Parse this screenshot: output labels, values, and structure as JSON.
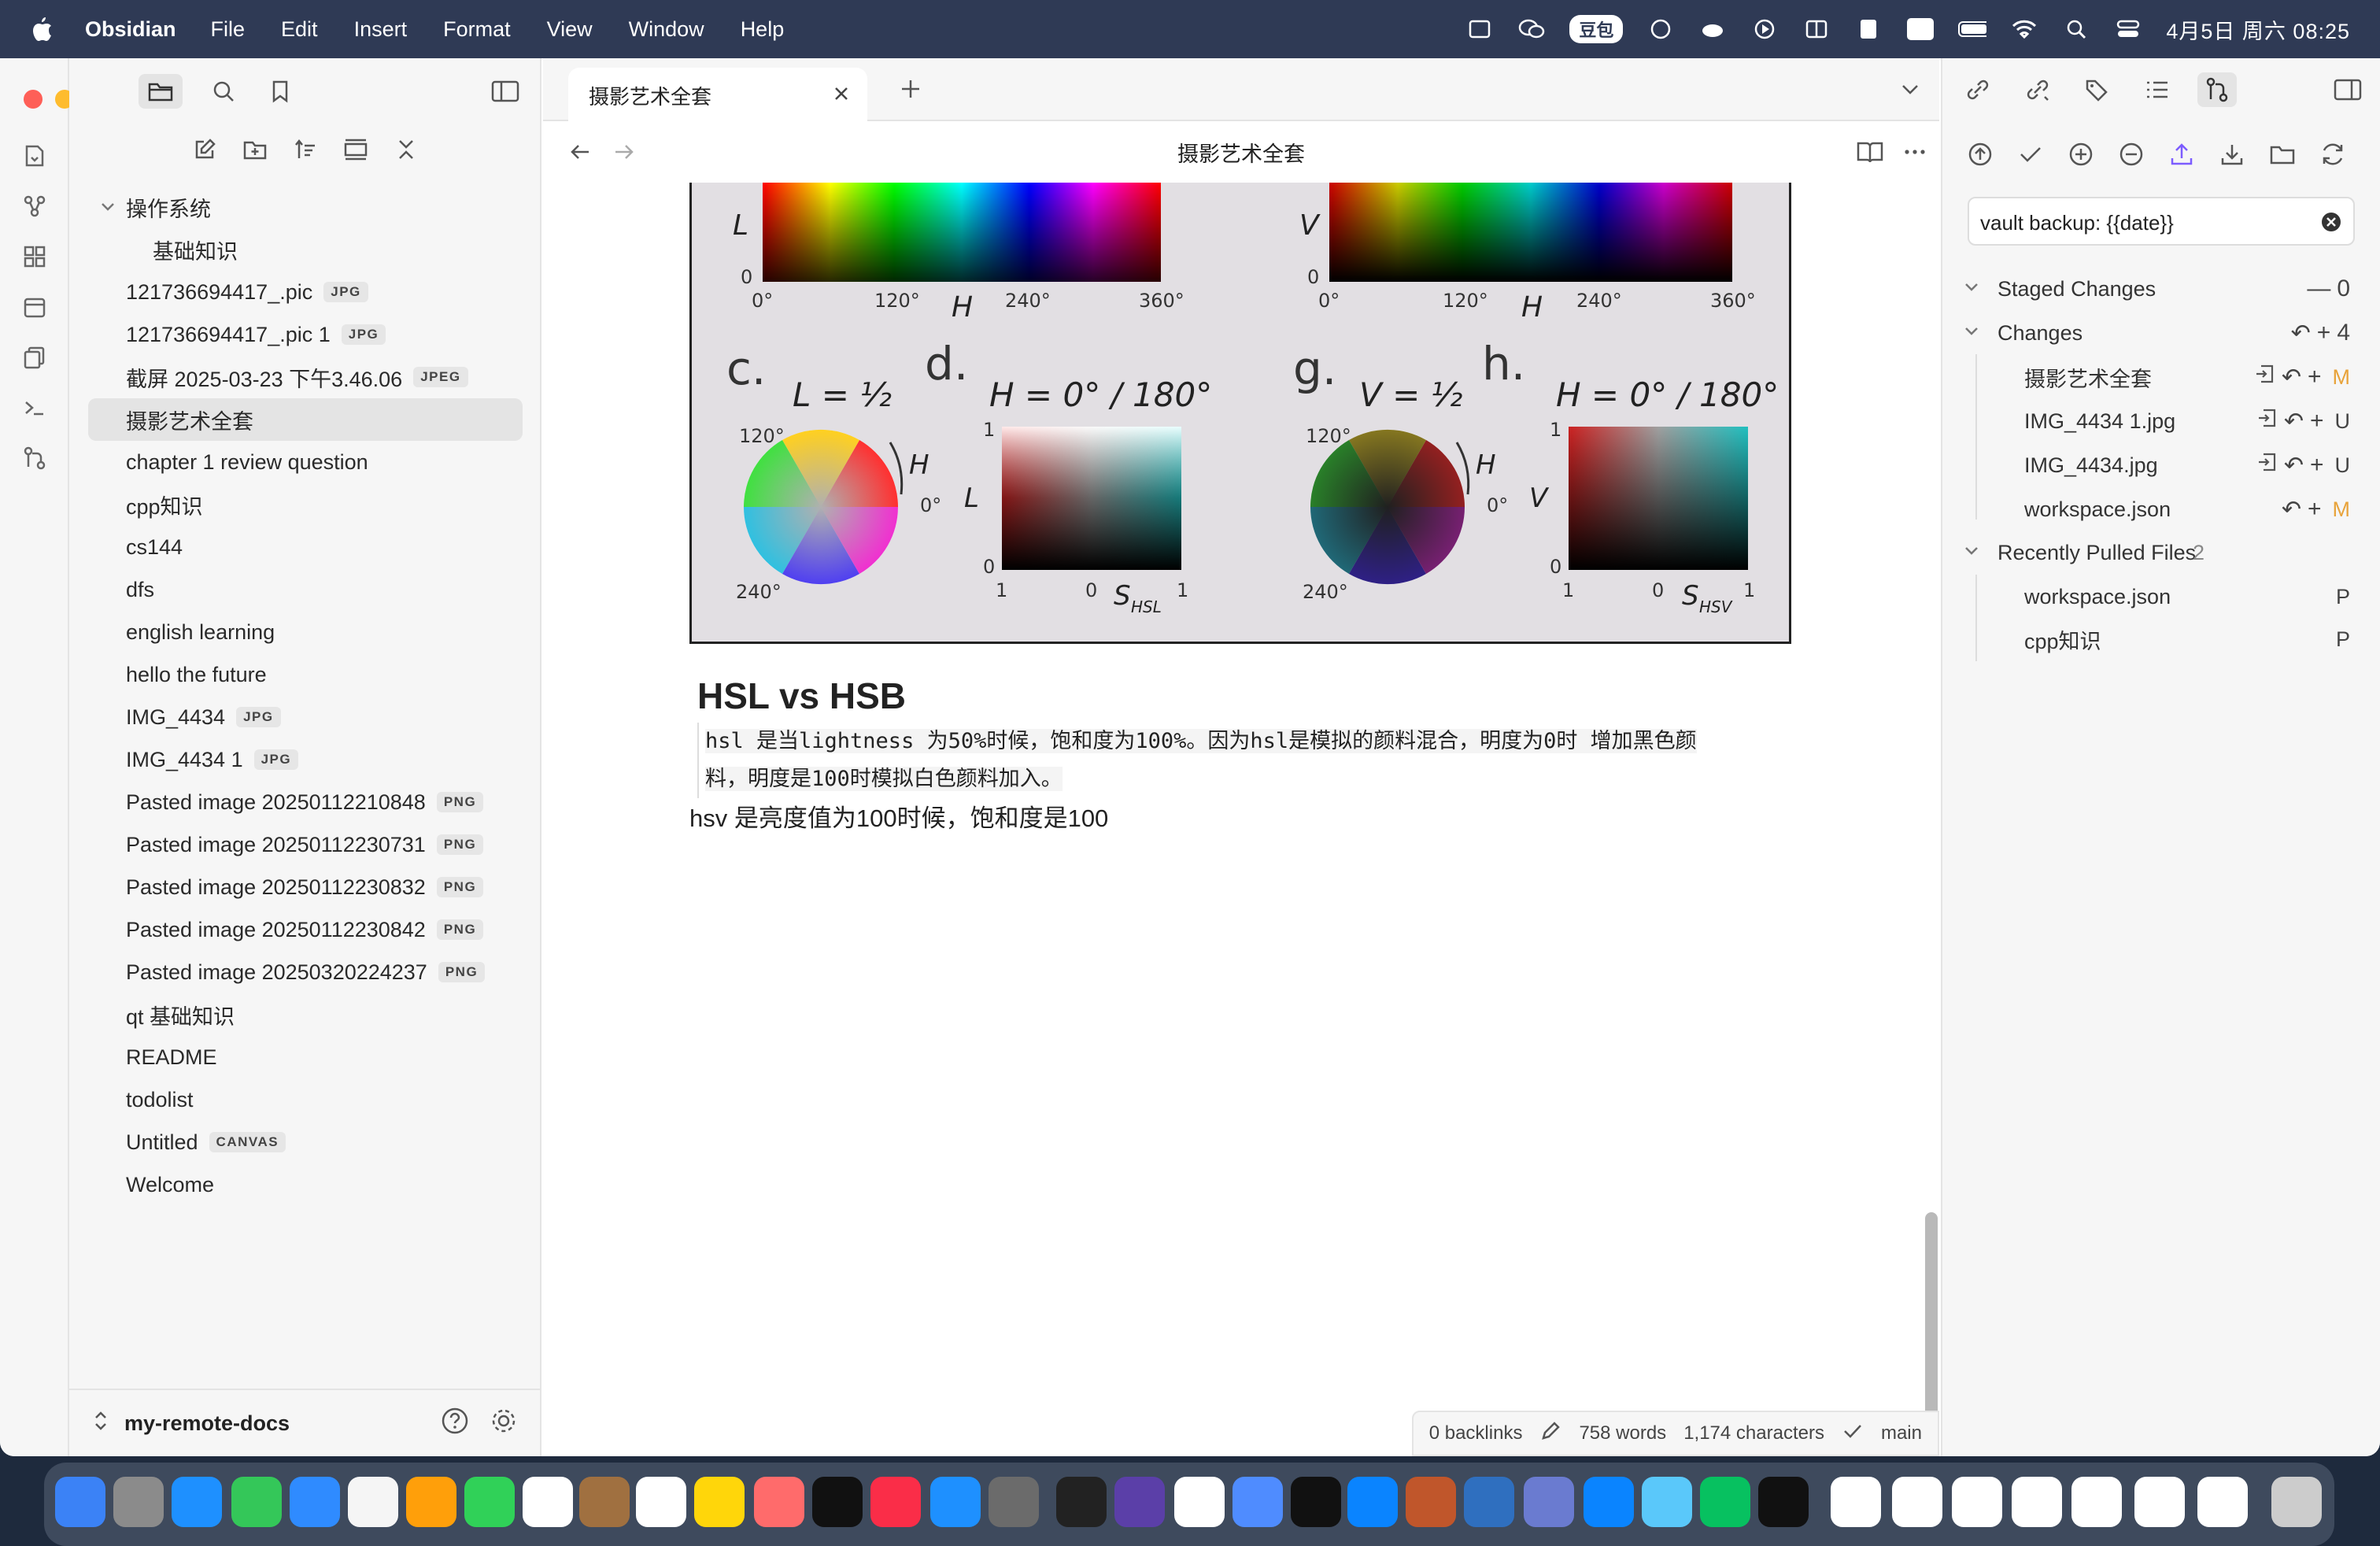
{
  "menubar": {
    "app": "Obsidian",
    "items": [
      "File",
      "Edit",
      "Insert",
      "Format",
      "View",
      "Window",
      "Help"
    ],
    "doubao": "豆包",
    "clock": "4月5日 周六  08:25"
  },
  "sidebar": {
    "tree": [
      {
        "label": "操作系统",
        "type": "folder"
      },
      {
        "label": "基础知识",
        "type": "child"
      },
      {
        "label": "121736694417_.pic",
        "badge": "JPG"
      },
      {
        "label": "121736694417_.pic 1",
        "badge": "JPG"
      },
      {
        "label": "截屏 2025-03-23 下午3.46.06",
        "badge": "JPEG"
      },
      {
        "label": "摄影艺术全套",
        "active": true
      },
      {
        "label": "chapter 1 review question"
      },
      {
        "label": "cpp知识"
      },
      {
        "label": "cs144"
      },
      {
        "label": "dfs"
      },
      {
        "label": "english learning"
      },
      {
        "label": "hello  the future"
      },
      {
        "label": "IMG_4434",
        "badge": "JPG"
      },
      {
        "label": "IMG_4434 1",
        "badge": "JPG"
      },
      {
        "label": "Pasted image 20250112210848",
        "badge": "PNG"
      },
      {
        "label": "Pasted image 20250112230731",
        "badge": "PNG"
      },
      {
        "label": "Pasted image 20250112230832",
        "badge": "PNG"
      },
      {
        "label": "Pasted image 20250112230842",
        "badge": "PNG"
      },
      {
        "label": "Pasted image 20250320224237",
        "badge": "PNG"
      },
      {
        "label": "qt 基础知识"
      },
      {
        "label": "README"
      },
      {
        "label": "todolist"
      },
      {
        "label": "Untitled",
        "badge": "CANVAS"
      },
      {
        "label": "Welcome"
      }
    ],
    "vault": "my-remote-docs"
  },
  "editor": {
    "tab_title": "摄影艺术全套",
    "view_title": "摄影艺术全套",
    "heading": "HSL vs HSB",
    "quote_line1": "  hsl 是当lightness 为50%时候，饱和度为100%。因为hsl是模拟的颜料混合，明度为0时 增加黑色颜",
    "quote_line2": "料，明度是100时模拟白色颜料加入。",
    "paragraph": "hsv 是亮度值为100时候，饱和度是100",
    "figure": {
      "ticks_h": [
        "0°",
        "120°",
        "240°",
        "360°"
      ],
      "axis_L": "L",
      "axis_V": "V",
      "axis_H": "H",
      "zero": "0",
      "panel_c": "c.",
      "panel_d": "d.",
      "panel_g": "g.",
      "panel_h": "h.",
      "title_c": "L = ½",
      "title_d": "H = 0° / 180°",
      "title_g": "V = ½",
      "title_h": "H = 0° / 180°",
      "wheel_120": "120°",
      "wheel_240": "240°",
      "wheel_0": "0°",
      "one": "1",
      "s_hsl": "S",
      "s_hsl_sub": "HSL",
      "s_hsv": "S",
      "s_hsv_sub": "HSV"
    }
  },
  "status": {
    "backlinks": "0 backlinks",
    "words": "758 words",
    "characters": "1,174 characters",
    "branch": "main"
  },
  "git": {
    "commit_message": "vault backup: {{date}}",
    "staged_label": "Staged Changes",
    "staged_count": "0",
    "changes_label": "Changes",
    "changes_count": "4",
    "changes": [
      {
        "name": "摄影艺术全套",
        "status": "M"
      },
      {
        "name": "IMG_4434 1.jpg",
        "status": "U"
      },
      {
        "name": "IMG_4434.jpg",
        "status": "U"
      },
      {
        "name": "workspace.json",
        "status": "M"
      }
    ],
    "pulled_label": "Recently Pulled Files",
    "pulled_count": "2",
    "pulled": [
      {
        "name": "workspace.json",
        "status": "P"
      },
      {
        "name": "cpp知识",
        "status": "P"
      }
    ]
  },
  "colors": {
    "accent": "#7c5cff",
    "modified": "#e8a33a",
    "menubar": "#2f3a55"
  }
}
